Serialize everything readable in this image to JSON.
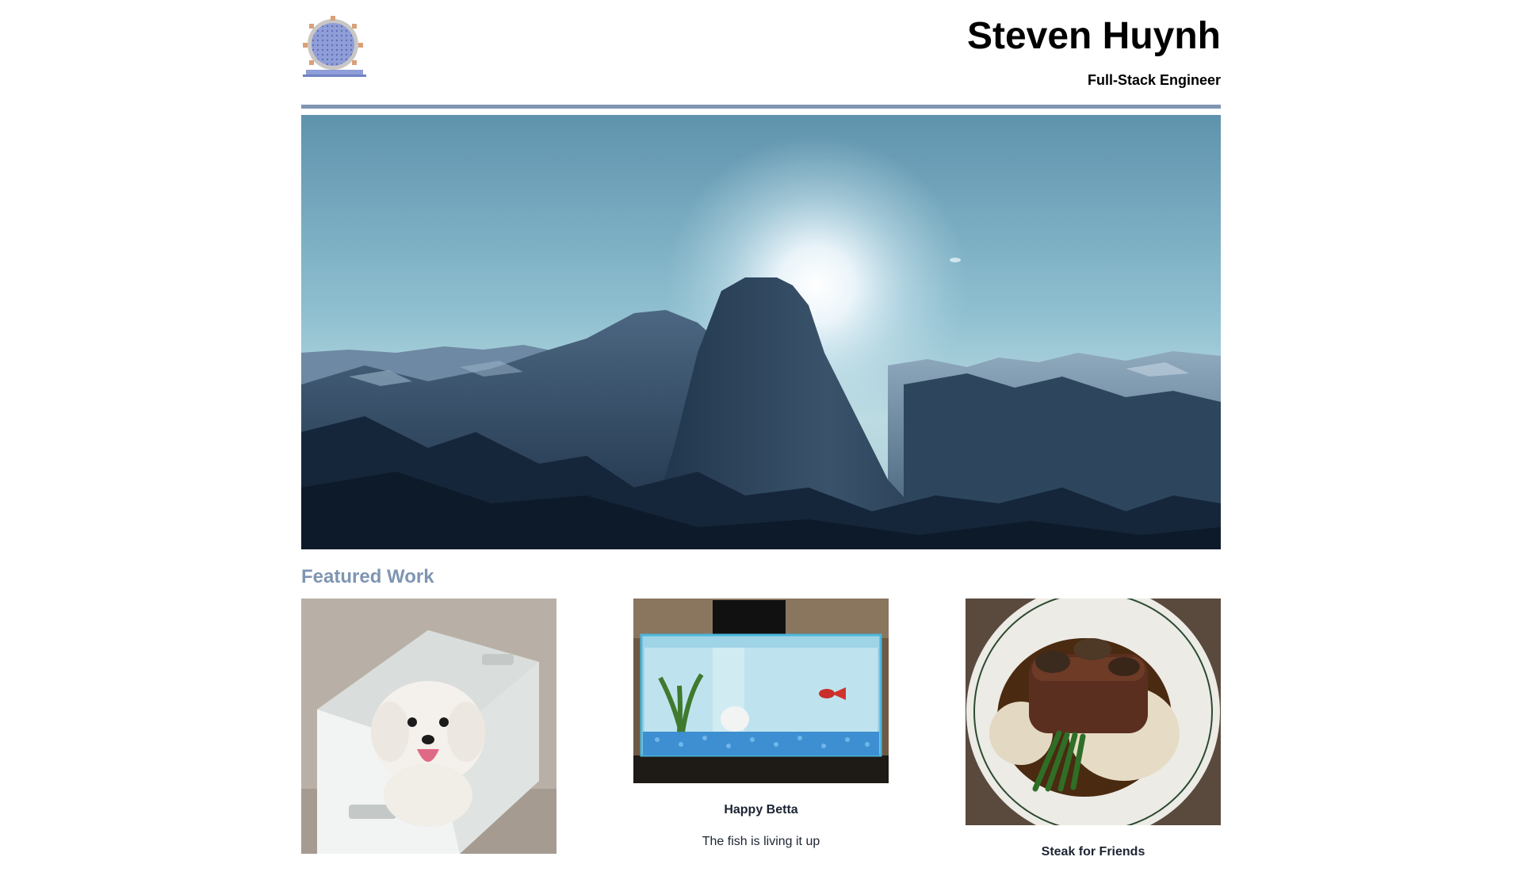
{
  "header": {
    "logo_icon": "porthole-logo-icon",
    "name": "Steven Huynh",
    "subtitle": "Full-Stack Engineer",
    "rule_color": "#7f95b2"
  },
  "hero": {
    "image": "mountain-sunrise-photo"
  },
  "featured": {
    "heading": "Featured Work",
    "heading_color": "#7f95b2",
    "items": [
      {
        "image": "dog-in-basket-photo",
        "title": "",
        "description": ""
      },
      {
        "image": "aquarium-photo",
        "title": "Happy Betta",
        "description": "The fish is living it up"
      },
      {
        "image": "steak-dinner-photo",
        "title": "Steak for Friends",
        "description": ""
      }
    ]
  }
}
